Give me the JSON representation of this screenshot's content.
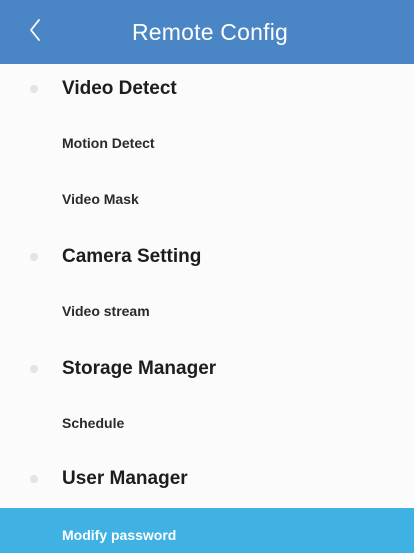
{
  "header": {
    "title": "Remote Config",
    "back_icon": "chevron-left-icon",
    "background_color": "#4a86c6"
  },
  "sections": [
    {
      "label": "Video Detect",
      "items": [
        {
          "label": "Motion Detect"
        },
        {
          "label": "Video Mask"
        }
      ]
    },
    {
      "label": "Camera Setting",
      "items": [
        {
          "label": "Video stream"
        }
      ]
    },
    {
      "label": "Storage Manager",
      "items": [
        {
          "label": "Schedule"
        }
      ]
    },
    {
      "label": "User Manager",
      "items": [
        {
          "label": "Modify password",
          "selected": true
        }
      ]
    }
  ],
  "colors": {
    "selected_background": "#3fb1e2",
    "section_text": "#1d1d1d",
    "item_text": "#2a2a2a"
  }
}
